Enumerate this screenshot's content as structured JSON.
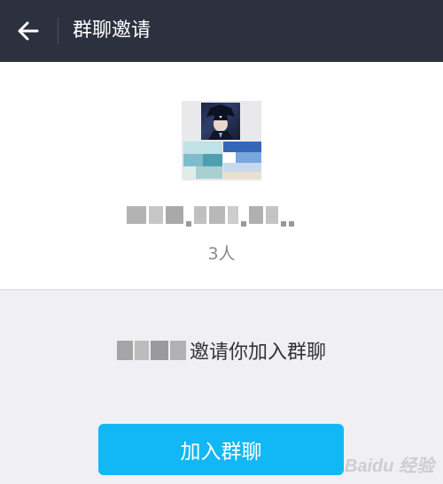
{
  "header": {
    "title": "群聊邀请",
    "back_icon": "arrow-left-icon",
    "background": "#2c313f"
  },
  "group": {
    "member_count": "3人"
  },
  "invitation": {
    "text": "邀请你加入群聊"
  },
  "actions": {
    "join_label": "加入群聊",
    "join_color": "#12b7f5"
  },
  "watermark": {
    "text": "Baidu 经验"
  }
}
